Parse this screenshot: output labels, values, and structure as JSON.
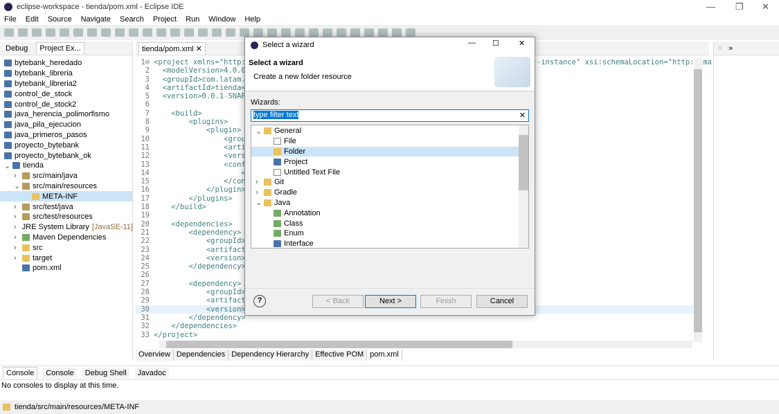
{
  "window": {
    "title": "eclipse-workspace - tienda/pom.xml - Eclipse IDE",
    "min": "—",
    "max": "❐",
    "close": "✕"
  },
  "menu": [
    "File",
    "Edit",
    "Source",
    "Navigate",
    "Search",
    "Project",
    "Run",
    "Window",
    "Help"
  ],
  "left_panel": {
    "tabs": [
      "Debug",
      "Project Ex..."
    ],
    "items": [
      {
        "label": "bytebank_heredado",
        "depth": 0,
        "icon": "project"
      },
      {
        "label": "bytebank_libreria",
        "depth": 0,
        "icon": "project"
      },
      {
        "label": "bytebank_libreria2",
        "depth": 0,
        "icon": "project"
      },
      {
        "label": "control_de_stock",
        "depth": 0,
        "icon": "project"
      },
      {
        "label": "control_de_stock2",
        "depth": 0,
        "icon": "project"
      },
      {
        "label": "java_herencia_polimorfismo",
        "depth": 0,
        "icon": "project"
      },
      {
        "label": "java_pila_ejecucion",
        "depth": 0,
        "icon": "project"
      },
      {
        "label": "java_primeros_pasos",
        "depth": 0,
        "icon": "project"
      },
      {
        "label": "proyecto_bytebank",
        "depth": 0,
        "icon": "project"
      },
      {
        "label": "proyecto_bytebank_ok",
        "depth": 0,
        "icon": "project"
      },
      {
        "label": "tienda",
        "depth": 0,
        "icon": "project",
        "toggle": "⌄"
      },
      {
        "label": "src/main/java",
        "depth": 1,
        "icon": "package",
        "toggle": "›"
      },
      {
        "label": "src/main/resources",
        "depth": 1,
        "icon": "package",
        "toggle": "⌄"
      },
      {
        "label": "META-INF",
        "depth": 2,
        "icon": "folder",
        "selected": true
      },
      {
        "label": "src/test/java",
        "depth": 1,
        "icon": "package",
        "toggle": "›"
      },
      {
        "label": "src/test/resources",
        "depth": 1,
        "icon": "package",
        "toggle": "›"
      },
      {
        "label": "JRE System Library",
        "extra": "[JavaSE-11]",
        "depth": 1,
        "icon": "library",
        "toggle": "›"
      },
      {
        "label": "Maven Dependencies",
        "depth": 1,
        "icon": "library",
        "toggle": "›"
      },
      {
        "label": "src",
        "depth": 1,
        "icon": "folder",
        "toggle": "›"
      },
      {
        "label": "target",
        "depth": 1,
        "icon": "folder",
        "toggle": "›"
      },
      {
        "label": "pom.xml",
        "depth": 1,
        "icon": "xml"
      }
    ]
  },
  "editor": {
    "tab": "tienda/pom.xml",
    "line1_right": "-instance\" xsi:schemaLocation=\"http://ma",
    "lines": [
      "<project xmlns=\"http:/",
      "  <modelVersion>4.0.0<",
      "  <groupId>com.latam.a",
      "  <artifactId>tienda</",
      "  <version>0.0.1-SNAPS",
      "",
      "    <build>",
      "        <plugins>",
      "            <plugin>",
      "                <group",
      "                <artif",
      "                <versi",
      "                <confi",
      "                    <",
      "                </conf",
      "            </plugin>",
      "        </plugins>",
      "    </build>",
      "",
      "    <dependencies>",
      "        <dependency>",
      "            <groupId>c",
      "            <artifactI",
      "            <version>5",
      "        </dependency>",
      "",
      "        <dependency>",
      "            <groupId>c",
      "            <artifactI",
      "            <version>2",
      "        </dependency>",
      "    </dependencies>",
      "</project>"
    ],
    "bottom_tabs": [
      "Overview",
      "Dependencies",
      "Dependency Hierarchy",
      "Effective POM",
      "pom.xml"
    ],
    "active_bottom_tab": "pom.xml"
  },
  "console": {
    "tabs": [
      "Console",
      "Console",
      "Debug Shell",
      "Javadoc"
    ],
    "message": "No consoles to display at this time."
  },
  "status": {
    "path": "tienda/src/main/resources/META-INF"
  },
  "dialog": {
    "title": "Select a wizard",
    "heading": "Select a wizard",
    "subtitle": "Create a new folder resource",
    "wizards_label": "Wizards:",
    "filter_value": "type filter text",
    "items": [
      {
        "label": "General",
        "depth": 0,
        "toggle": "⌄",
        "icon": "folder"
      },
      {
        "label": "File",
        "depth": 1,
        "icon": "file"
      },
      {
        "label": "Folder",
        "depth": 1,
        "icon": "folder",
        "selected": true
      },
      {
        "label": "Project",
        "depth": 1,
        "icon": "project"
      },
      {
        "label": "Untitled Text File",
        "depth": 1,
        "icon": "file"
      },
      {
        "label": "Git",
        "depth": 0,
        "toggle": "›",
        "icon": "folder"
      },
      {
        "label": "Gradle",
        "depth": 0,
        "toggle": "›",
        "icon": "folder"
      },
      {
        "label": "Java",
        "depth": 0,
        "toggle": "⌄",
        "icon": "folder"
      },
      {
        "label": "Annotation",
        "depth": 1,
        "icon": "annotation"
      },
      {
        "label": "Class",
        "depth": 1,
        "icon": "class"
      },
      {
        "label": "Enum",
        "depth": 1,
        "icon": "enum"
      },
      {
        "label": "Interface",
        "depth": 1,
        "icon": "interface"
      }
    ],
    "buttons": {
      "back": "< Back",
      "next": "Next >",
      "finish": "Finish",
      "cancel": "Cancel"
    },
    "help": "?"
  }
}
